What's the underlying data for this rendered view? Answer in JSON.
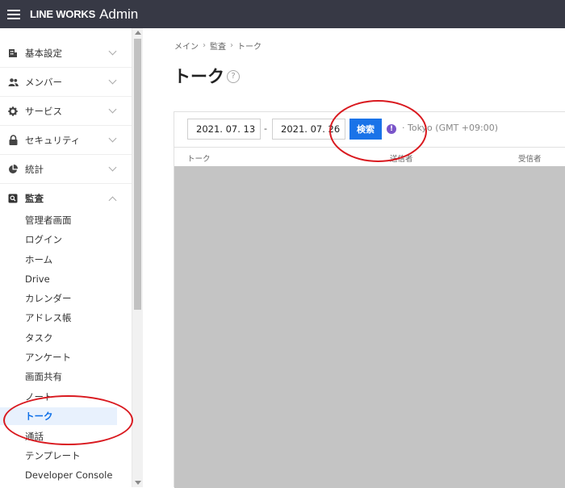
{
  "app": {
    "logo": "LINE WORKS",
    "logo_sub": "Admin"
  },
  "sidebar": {
    "groups": [
      {
        "label": "基本設定",
        "icon": "building-icon"
      },
      {
        "label": "メンバー",
        "icon": "members-icon"
      },
      {
        "label": "サービス",
        "icon": "gear-icon"
      },
      {
        "label": "セキュリティ",
        "icon": "lock-icon"
      },
      {
        "label": "統計",
        "icon": "pie-chart-icon"
      },
      {
        "label": "監査",
        "icon": "audit-search-icon"
      }
    ],
    "audit_items": [
      "管理者画面",
      "ログイン",
      "ホーム",
      "Drive",
      "カレンダー",
      "アドレス帳",
      "タスク",
      "アンケート",
      "画面共有",
      "ノート",
      "トーク",
      "通話",
      "テンプレート",
      "Developer Console"
    ],
    "active_item": "トーク"
  },
  "breadcrumb": [
    "メイン",
    "監査",
    "トーク"
  ],
  "page_title": "トーク",
  "search": {
    "date_from": "2021. 07. 13",
    "date_to": "2021. 07. 26",
    "separator": "-",
    "button_label": "検索",
    "timezone": "· Tokyo (GMT +09:00)"
  },
  "table": {
    "columns": [
      "トーク",
      "送信者",
      "受信者"
    ]
  },
  "colors": {
    "topbar": "#373945",
    "accent": "#1a73e8",
    "annotation": "#d9191f"
  }
}
